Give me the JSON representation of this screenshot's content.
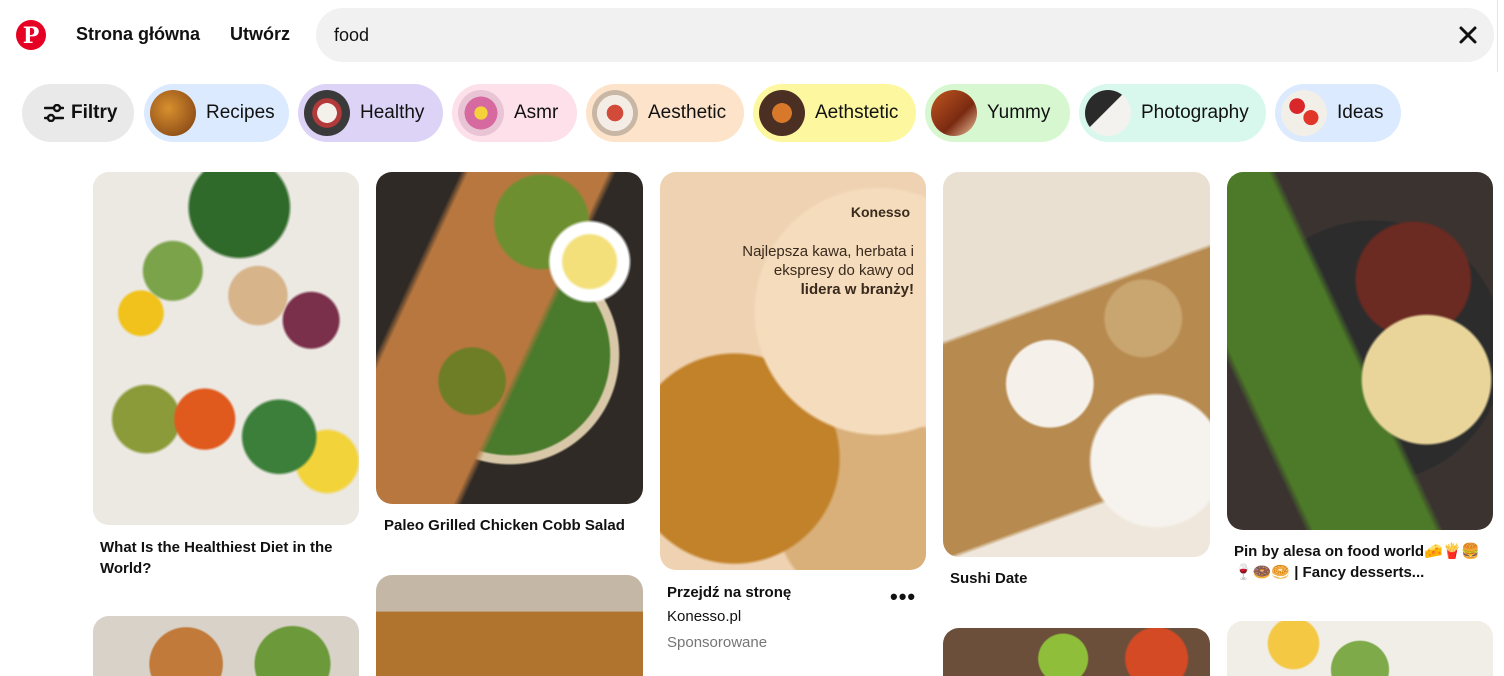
{
  "header": {
    "logo_letter": "P",
    "nav": {
      "home": "Strona główna",
      "create": "Utwórz"
    },
    "search": {
      "value": "food",
      "clear_icon": "close-icon"
    }
  },
  "chips": {
    "filter_label": "Filtry",
    "filter_icon": "sliders-icon",
    "items": [
      {
        "label": "Recipes",
        "color": "#dbeafe"
      },
      {
        "label": "Healthy",
        "color": "#dcd3f7"
      },
      {
        "label": "Asmr",
        "color": "#fde0ea"
      },
      {
        "label": "Aesthetic",
        "color": "#fde3c9"
      },
      {
        "label": "Aethstetic",
        "color": "#fdf8a0"
      },
      {
        "label": "Yummy",
        "color": "#d6f7cf"
      },
      {
        "label": "Photography",
        "color": "#d8f8ee"
      },
      {
        "label": "Ideas",
        "color": "#dbeafe"
      }
    ]
  },
  "pins": {
    "pin1": {
      "title": "What Is the Healthiest Diet in the World?"
    },
    "pin2": {
      "title": "Paleo Grilled Chicken Cobb Salad"
    },
    "pin3": {
      "image_brand": "Konesso",
      "image_text_1": "Najlepsza kawa, herbata i ekspresy do kawy od",
      "image_text_2": "lidera w branży!",
      "title": "Przejdź na stronę",
      "domain": "Konesso.pl",
      "sponsored": "Sponsorowane",
      "more_icon": "more-dots-icon"
    },
    "pin4": {
      "title": "Sushi Date"
    },
    "pin5": {
      "title": "Pin by alesa on food world🧀🍟🍔🍷🍩🥯 | Fancy desserts..."
    }
  },
  "colors": {
    "brand": "#e60023",
    "search_bg": "#f1f1f1",
    "filter_chip_bg": "#e9e9e9",
    "muted_text": "#767676"
  }
}
